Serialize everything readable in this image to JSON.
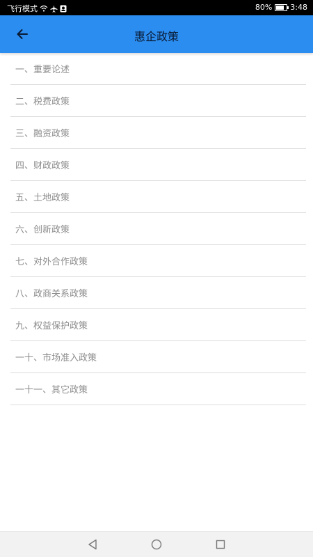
{
  "status_bar": {
    "left_text": "飞行模式",
    "battery": "80%",
    "battery_level": 0.8,
    "time": "3:48"
  },
  "app_bar": {
    "title": "惠企政策",
    "back_icon": "arrow-left-icon",
    "background_color": "#2b8df0"
  },
  "policies": [
    "一、重要论述",
    "二、税费政策",
    "三、融资政策",
    "四、财政政策",
    "五、土地政策",
    "六、创新政策",
    "七、对外合作政策",
    "八、政商关系政策",
    "九、权益保护政策",
    "一十、市场准入政策",
    "一十一、其它政策"
  ],
  "nav_bar": {
    "back_icon": "triangle-back-icon",
    "home_icon": "circle-home-icon",
    "recents_icon": "square-recents-icon"
  }
}
